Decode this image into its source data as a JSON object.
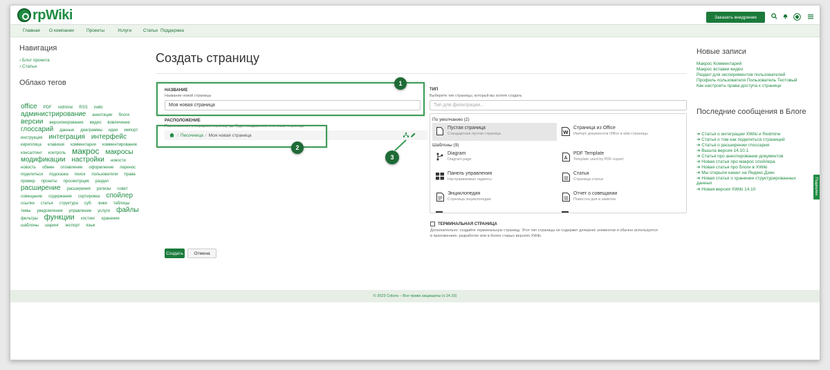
{
  "header": {
    "logo_text": "rpWiki",
    "order_button": "Заказать внедрение",
    "brand_color": "#1f8c43"
  },
  "nav": {
    "items": [
      "Главная",
      "О компании",
      "Проекты",
      "Услуги",
      "Статьи",
      "Поддержка"
    ]
  },
  "left_sidebar": {
    "nav_title": "Навигация",
    "nav_links": [
      "› Блог проекта",
      "› Статьи"
    ],
    "tags_title": "Облако тегов",
    "tags": [
      {
        "t": "office",
        "s": 10
      },
      {
        "t": "PDF",
        "s": 6
      },
      {
        "t": "redmine",
        "s": 6
      },
      {
        "t": "RSS",
        "s": 6
      },
      {
        "t": "xwiki",
        "s": 6
      },
      {
        "t": "администрирование",
        "s": 10
      },
      {
        "t": "аннотации",
        "s": 6
      },
      {
        "t": "блоги",
        "s": 6
      },
      {
        "t": "версии",
        "s": 10
      },
      {
        "t": "версионирование",
        "s": 6
      },
      {
        "t": "видео",
        "s": 6
      },
      {
        "t": "вовлечение",
        "s": 6
      },
      {
        "t": "глоссарий",
        "s": 10
      },
      {
        "t": "данные",
        "s": 6
      },
      {
        "t": "диаграммы",
        "s": 6
      },
      {
        "t": "идеи",
        "s": 6
      },
      {
        "t": "импорт",
        "s": 6
      },
      {
        "t": "инструкция",
        "s": 6
      },
      {
        "t": "интеграция",
        "s": 10
      },
      {
        "t": "интерфейс",
        "s": 10
      },
      {
        "t": "кириллица",
        "s": 6
      },
      {
        "t": "клавиши",
        "s": 6
      },
      {
        "t": "комментарии",
        "s": 6
      },
      {
        "t": "комментирование",
        "s": 6
      },
      {
        "t": "консалтинг",
        "s": 6
      },
      {
        "t": "контроль",
        "s": 6
      },
      {
        "t": "макрос",
        "s": 12
      },
      {
        "t": "макросы",
        "s": 10
      },
      {
        "t": "модификации",
        "s": 10
      },
      {
        "t": "настройки",
        "s": 10
      },
      {
        "t": "новости",
        "s": 6
      },
      {
        "t": "новость",
        "s": 6
      },
      {
        "t": "обмен",
        "s": 6
      },
      {
        "t": "оглавление",
        "s": 6
      },
      {
        "t": "оформление",
        "s": 6
      },
      {
        "t": "перенос",
        "s": 6
      },
      {
        "t": "поделиться",
        "s": 6
      },
      {
        "t": "подсказка",
        "s": 6
      },
      {
        "t": "поиск",
        "s": 6
      },
      {
        "t": "пользователи",
        "s": 6
      },
      {
        "t": "права",
        "s": 6
      },
      {
        "t": "пример",
        "s": 6
      },
      {
        "t": "проекты",
        "s": 6
      },
      {
        "t": "просмотрщик",
        "s": 6
      },
      {
        "t": "раздел",
        "s": 6
      },
      {
        "t": "расширение",
        "s": 10
      },
      {
        "t": "расширения",
        "s": 6
      },
      {
        "t": "релизы",
        "s": 6
      },
      {
        "t": "совет",
        "s": 6
      },
      {
        "t": "совещание",
        "s": 6
      },
      {
        "t": "содержание",
        "s": 6
      },
      {
        "t": "сортировка",
        "s": 6
      },
      {
        "t": "спойлер",
        "s": 10
      },
      {
        "t": "ссылки",
        "s": 6
      },
      {
        "t": "статья",
        "s": 6
      },
      {
        "t": "структура",
        "s": 6
      },
      {
        "t": "суб-",
        "s": 6
      },
      {
        "t": "вики",
        "s": 6
      },
      {
        "t": "таблицы",
        "s": 6
      },
      {
        "t": "темы",
        "s": 6
      },
      {
        "t": "уведомления",
        "s": 6
      },
      {
        "t": "управление",
        "s": 6
      },
      {
        "t": "услуги",
        "s": 6
      },
      {
        "t": "файлы",
        "s": 10
      },
      {
        "t": "фильтры",
        "s": 6
      },
      {
        "t": "функции",
        "s": 11
      },
      {
        "t": "хостинг",
        "s": 6
      },
      {
        "t": "хранение",
        "s": 6
      },
      {
        "t": "шаблоны",
        "s": 6
      },
      {
        "t": "шаринг",
        "s": 6
      },
      {
        "t": "экспорт",
        "s": 6
      },
      {
        "t": "язык",
        "s": 6
      }
    ]
  },
  "main": {
    "title": "Создать страницу",
    "name_label": "НАЗВАНИЕ",
    "name_hint": "Название новой страницы",
    "name_value": "Моя новая страница",
    "location_label": "РАСПОЛОЖЕНИЕ",
    "location_hint": "Расположение в иерархии страниц, где будет создаваться эта новая страница.",
    "breadcrumb": [
      "Песочница",
      "Моя новая страница"
    ],
    "type_label": "ТИП",
    "type_hint": "Выберите тип страницы, который вы хотите создать",
    "type_filter_placeholder": "Тип для фильтрации...",
    "default_group": "По умолчанию (2)",
    "templates_group": "Шаблоны (9)",
    "types": [
      {
        "name": "Пустая страница",
        "desc": "Стандартная пустая страница",
        "icon": "blank-page-icon",
        "selected": true
      },
      {
        "name": "Страница из Office",
        "desc": "Импорт документов Office в wiki-страницы",
        "icon": "word-icon",
        "selected": false
      },
      {
        "name": "Diagram",
        "desc": "Diagram page",
        "icon": "diagram-icon",
        "selected": false
      },
      {
        "name": "PDF Template",
        "desc": "Template used by PDF export",
        "icon": "pdf-icon",
        "selected": false
      },
      {
        "name": "Панель управления",
        "desc": "Настраиваемые гаджеты",
        "icon": "dashboard-icon",
        "selected": false
      },
      {
        "name": "Статья",
        "desc": "Страница статьи",
        "icon": "article-icon",
        "selected": false
      },
      {
        "name": "Энциклопедия",
        "desc": "Страница энциклопедии",
        "icon": "encyclopedia-icon",
        "selected": false
      },
      {
        "name": "Отчет о совещании",
        "desc": "Повестка дня и заметки",
        "icon": "meeting-icon",
        "selected": false
      }
    ],
    "terminal_label": "ТЕРМИНАЛЬНАЯ СТРАНИЦА",
    "terminal_desc1": "Дополнительно: создайте терминальную страницу. Этот тип страницы не содержит дочерних элементов и обычно используется",
    "terminal_desc2": "в приложениях, разработке или в более старых версиях XWiki.",
    "create_button": "Создать",
    "cancel_button": "Отмена",
    "badges": [
      "1",
      "2",
      "3"
    ]
  },
  "right_sidebar": {
    "recent_title": "Новые записи",
    "recent": [
      "Макрос Комментарий",
      "Макрос вставки видео",
      "Раздел для экспериментов пользователей",
      "Профиль пользователя Пользователь Тестовый",
      "Как настроить права доступа к странице"
    ],
    "blog_title": "Последние сообщения в Блоге",
    "blog": [
      "Статья о интеграции XWiki и Redmine",
      "Статья о том как поделиться страницей",
      "Статья о расширении глоссария",
      "Вышла версия 14.10.1",
      "Статья про аннотирование документов",
      "Новая статья про макрос спойлера",
      "Новая статья про блоги в XWiki",
      "Мы открыли канал на Яндекс.Дзен",
      "Новая статья о хранении структурированных",
      "данных",
      "Новая версия XWiki 14.10"
    ]
  },
  "support_tab": "Поддержка",
  "footer": "© 2023 Coluns – Все права защищены (v.14.10)"
}
